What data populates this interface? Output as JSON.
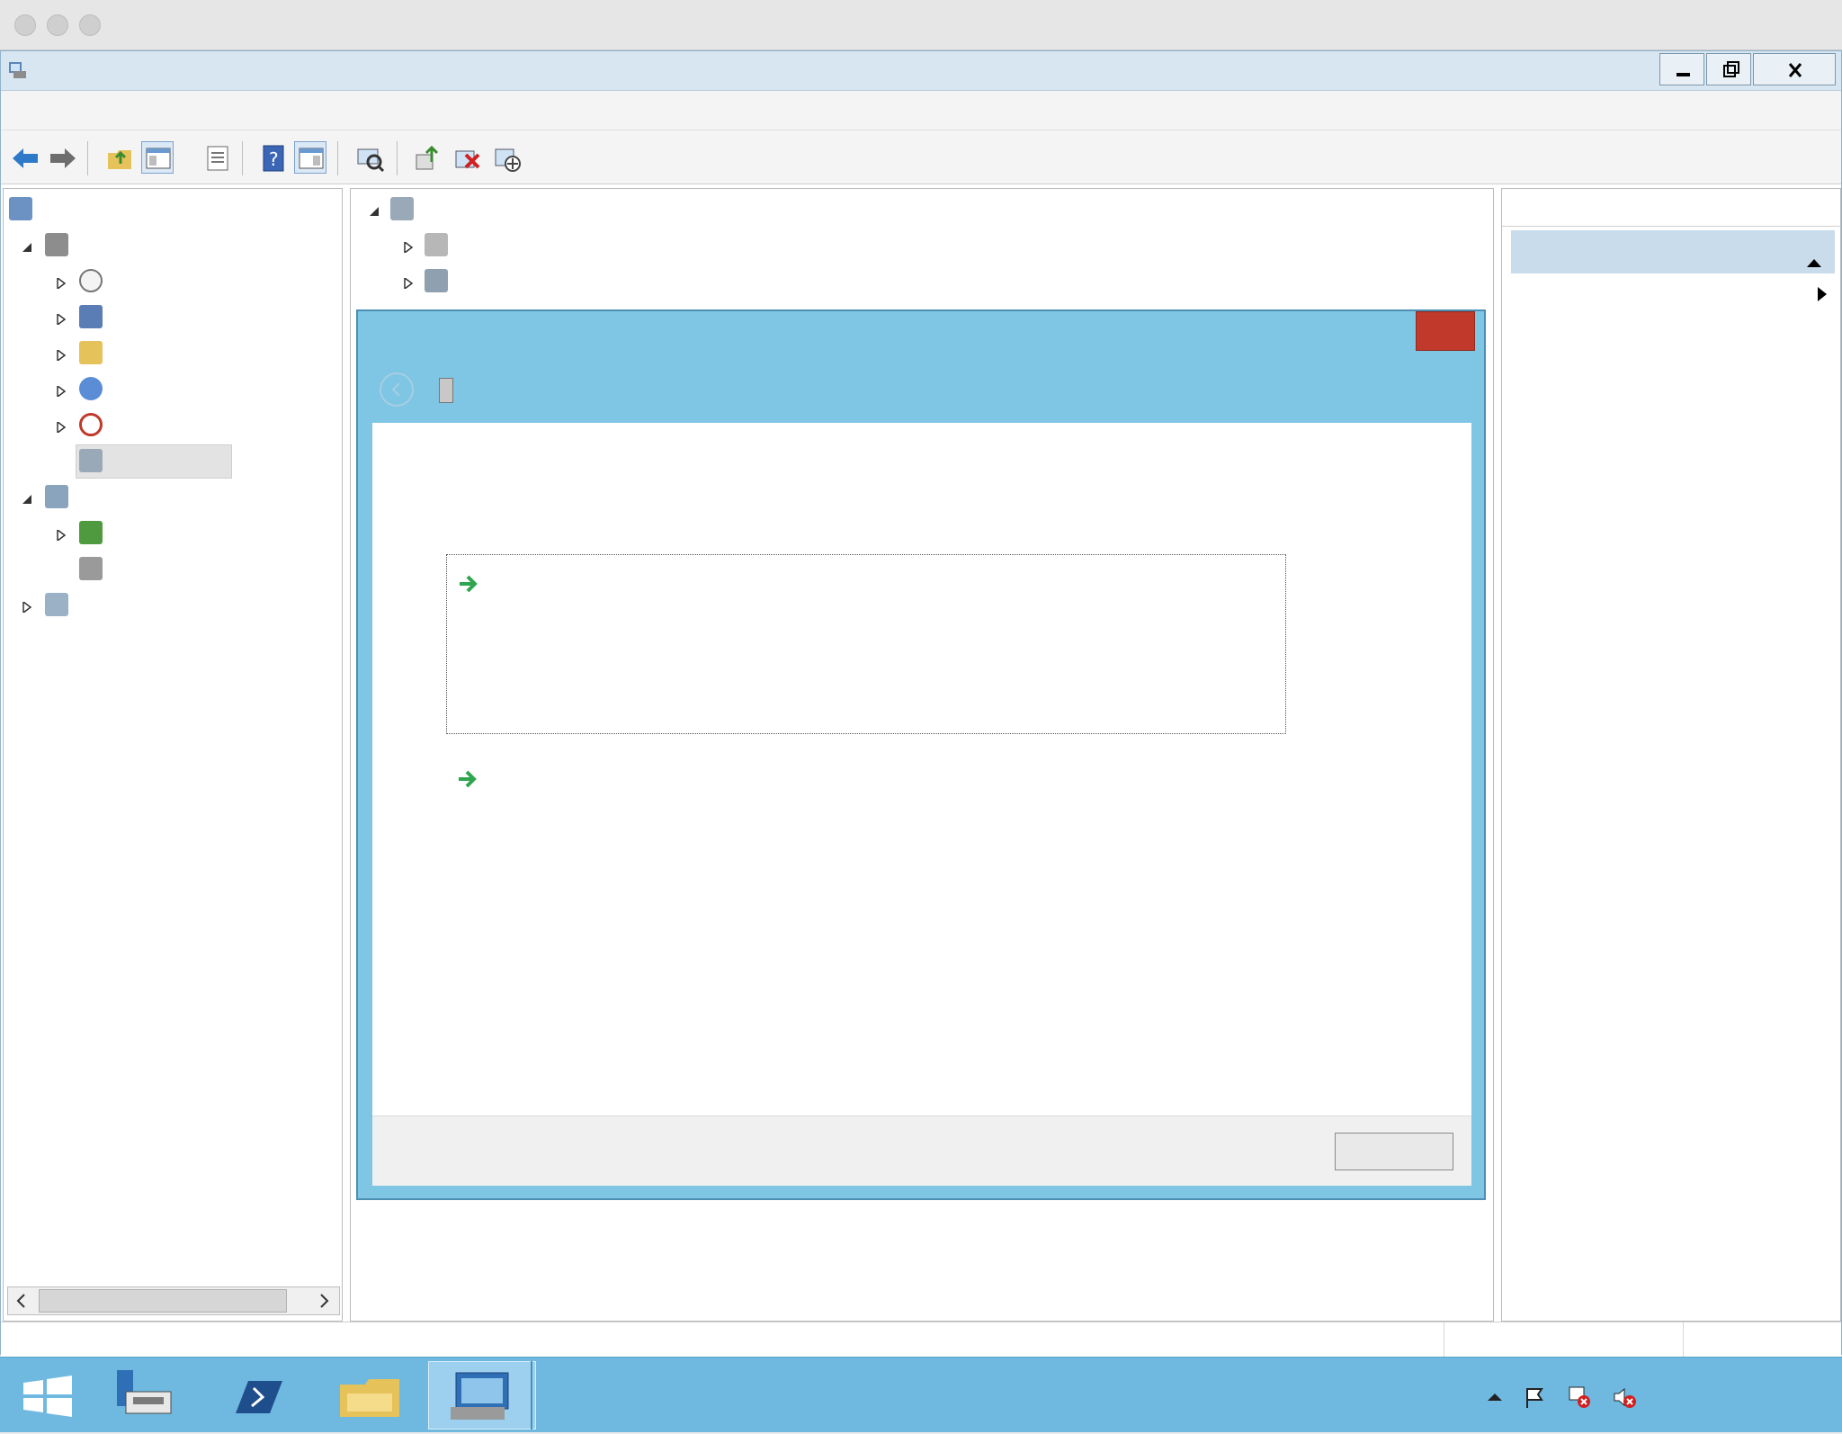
{
  "mac": {
    "window_title": ""
  },
  "window": {
    "title": ""
  },
  "menu": {
    "items": [
      "",
      "",
      "",
      ""
    ]
  },
  "toolbar": {
    "icons": [
      "back-icon",
      "forward-icon",
      "up-folder-icon",
      "show-hide-console-tree-icon",
      "properties-icon",
      "help-icon",
      "show-hide-action-pane-icon",
      "scan-hardware-icon",
      "update-driver-icon",
      "uninstall-icon",
      "disable-icon"
    ]
  },
  "tree": {
    "root": "",
    "system_tools": "",
    "task_scheduler": "",
    "event_viewer": "",
    "shared_folders": "",
    "local_users": "",
    "performance": "",
    "device_manager": "",
    "storage": "",
    "wsb": "",
    "disk_management": "",
    "services_apps": "",
    "scroll_thumb": ""
  },
  "devices": {
    "computer": "",
    "dvd": "",
    "ide": ""
  },
  "actions": {
    "header": "",
    "section": "",
    "more": ""
  },
  "dialog": {
    "title": "",
    "question": "",
    "option1_title": "",
    "option1_desc": "",
    "option2_title": "",
    "option2_desc": "",
    "cancel": "",
    "close": ""
  },
  "taskbar": {
    "apps": [
      "start-icon",
      "server-manager-icon",
      "powershell-icon",
      "file-explorer-icon",
      "computer-management-icon"
    ],
    "ime": "",
    "time": "",
    "date": ""
  },
  "colors": {
    "accent": "#7fc5e4",
    "taskbar": "#6fb9e0",
    "link": "#1f4e8c",
    "close": "#c0392b",
    "arrow": "#2ea54e"
  }
}
